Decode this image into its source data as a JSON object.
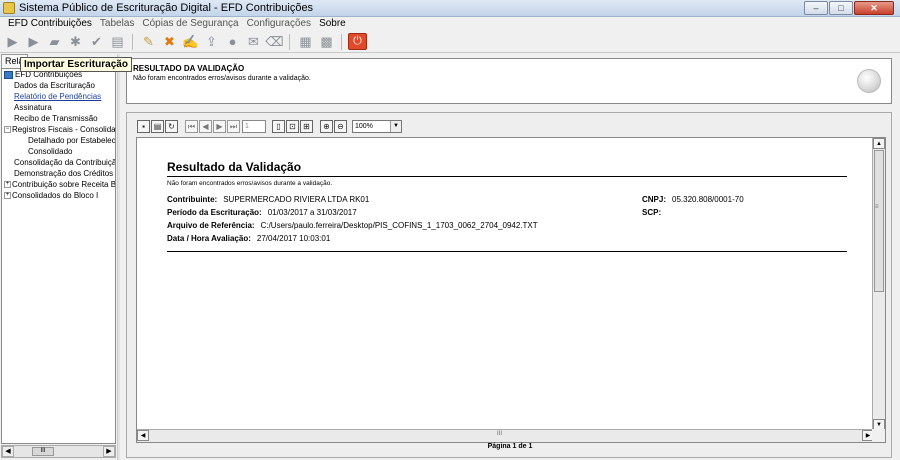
{
  "window": {
    "title": "Sistema Público de Escrituração Digital - EFD Contribuições",
    "minimize": "–",
    "maximize": "□",
    "close": "✕"
  },
  "menu": [
    "EFD Contribuições",
    "Tabelas",
    "Cópias de Segurança",
    "Configurações",
    "Sobre"
  ],
  "tooltip": "Importar Escrituração",
  "left_panel": {
    "tab_label": "Rela",
    "tree": [
      {
        "label": "EFD Contribuições",
        "kind": "root"
      },
      {
        "label": "Dados da Escrituração",
        "kind": "leaf"
      },
      {
        "label": "Relatório de Pendências",
        "kind": "link"
      },
      {
        "label": "Assinatura",
        "kind": "leaf"
      },
      {
        "label": "Recibo de Transmissão",
        "kind": "leaf"
      },
      {
        "label": "Registros Fiscais - Consolidaçã",
        "kind": "expanded"
      },
      {
        "label": "Detalhado por Estabelecime",
        "kind": "child"
      },
      {
        "label": "Consolidado",
        "kind": "child"
      },
      {
        "label": "Consolidação da Contribuição d",
        "kind": "leaf"
      },
      {
        "label": "Demonstração dos Créditos Ap",
        "kind": "leaf"
      },
      {
        "label": "Contribuição sobre Receita Bru",
        "kind": "collapsed"
      },
      {
        "label": "Consolidados do Bloco I",
        "kind": "collapsed"
      }
    ],
    "scroll_grip": "III"
  },
  "validation": {
    "title": "RESULTADO DA VALIDAÇÃO",
    "message": "Não foram encontrados erros/avisos durante a validação."
  },
  "viewer": {
    "page_input": "1",
    "zoom": "100%",
    "footer": "Página 1 de 1",
    "scroll_grip": "III",
    "vscroll_grip": "≡"
  },
  "report": {
    "title": "Resultado da Validação",
    "note": "Não foram encontrados erros/avisos durante a validação.",
    "fields": {
      "contribuinte_label": "Contribuinte:",
      "contribuinte_value": "SUPERMERCADO RIVIERA LTDA RK01",
      "periodo_label": "Período da Escrituração:",
      "periodo_value": "01/03/2017 a 31/03/2017",
      "arquivo_label": "Arquivo de Referência:",
      "arquivo_value": "C:/Users/paulo.ferreira/Desktop/PIS_COFINS_1_1703_0062_2704_0942.TXT",
      "data_label": "Data / Hora Avaliação:",
      "data_value": "27/04/2017 10:03:01",
      "cnpj_label": "CNPJ:",
      "cnpj_value": "05.320.808/0001-70",
      "scp_label": "SCP:"
    }
  }
}
